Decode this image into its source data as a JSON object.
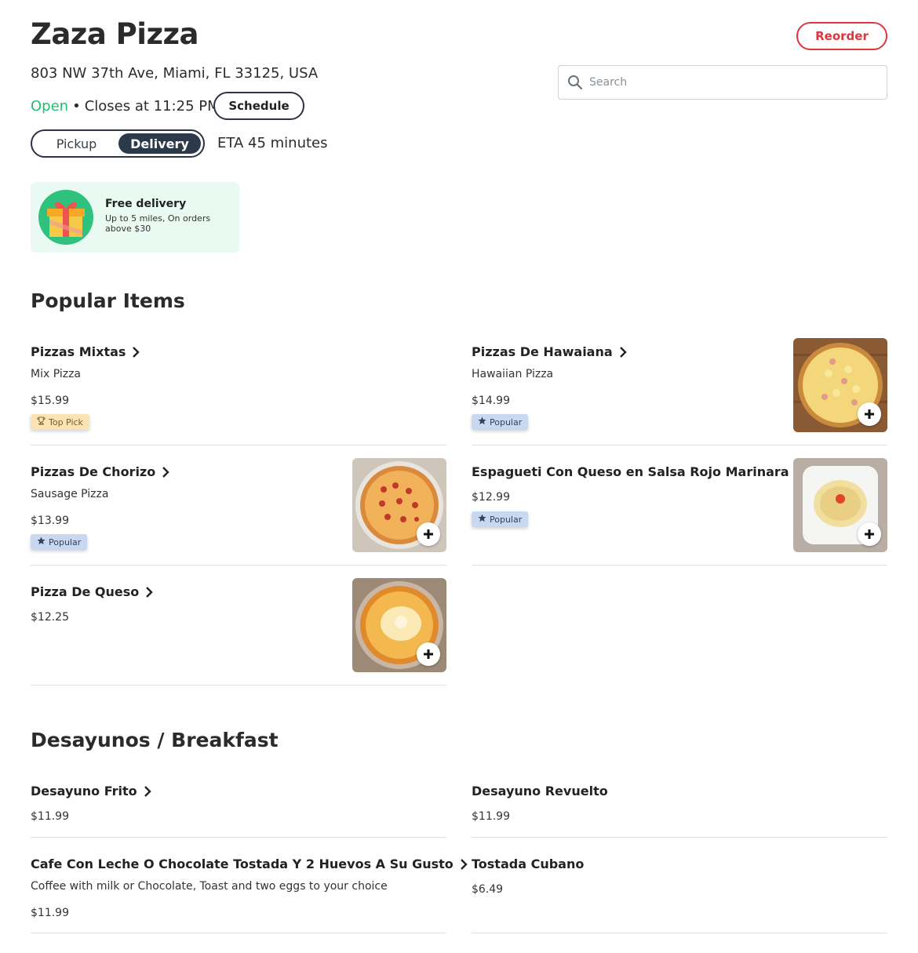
{
  "restaurant": {
    "name": "Zaza Pizza",
    "address": "803 NW 37th Ave, Miami, FL 33125, USA",
    "open_status": "Open",
    "closes": "Closes at 11:25 PM",
    "separator": "•"
  },
  "header": {
    "reorder_label": "Reorder",
    "schedule_label": "Schedule",
    "search_placeholder": "Search"
  },
  "order_mode": {
    "options": [
      "Pickup",
      "Delivery"
    ],
    "selected": "Delivery",
    "eta": "ETA 45 minutes"
  },
  "promo": {
    "title": "Free delivery",
    "subtitle": "Up to 5 miles, On orders above $30"
  },
  "sections": [
    {
      "title": "Popular Items",
      "items": [
        {
          "name": "Pizzas Mixtas",
          "desc": "Mix Pizza",
          "price": "$15.99",
          "badge": "Top Pick"
        },
        {
          "name": "Pizzas De Hawaiana",
          "desc": "Hawaiian Pizza",
          "price": "$14.99",
          "badge": "Popular"
        },
        {
          "name": "Pizzas De Chorizo",
          "desc": "Sausage Pizza",
          "price": "$13.99",
          "badge": "Popular"
        },
        {
          "name": "Espagueti Con Queso en Salsa Rojo Marinara",
          "price": "$12.99",
          "badge": "Popular"
        },
        {
          "name": "Pizza De Queso",
          "price": "$12.25"
        }
      ]
    },
    {
      "title": "Desayunos / Breakfast",
      "items": [
        {
          "name": "Desayuno Frito",
          "price": "$11.99"
        },
        {
          "name": "Desayuno Revuelto",
          "price": "$11.99"
        },
        {
          "name": "Cafe Con Leche O Chocolate Tostada Y 2 Huevos A Su Gusto",
          "desc": "Coffee with milk or Chocolate, Toast and two eggs to your choice",
          "price": "$11.99"
        },
        {
          "name": "Tostada Cubano",
          "price": "$6.49"
        }
      ]
    }
  ],
  "colors": {
    "accent_red": "#e0353b",
    "open_green": "#1fbf72",
    "dark_navy": "#2b3a4a",
    "promo_bg": "#e8faf2"
  }
}
